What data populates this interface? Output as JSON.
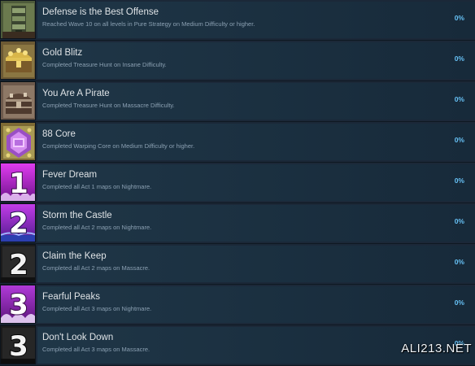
{
  "achievements": [
    {
      "title": "Defense is the Best Offense",
      "desc": "Reached Wave 10 on all levels in Pure Strategy on Medium Difficulty or higher.",
      "percent": "0%",
      "icon": "tower-icon"
    },
    {
      "title": "Gold Blitz",
      "desc": "Completed Treasure Hunt on Insane Difficulty.",
      "percent": "0%",
      "icon": "treasure-chest-icon"
    },
    {
      "title": "You Are A Pirate",
      "desc": "Completed Treasure Hunt on Massacre Difficulty.",
      "percent": "0%",
      "icon": "pirate-chest-icon"
    },
    {
      "title": "88 Core",
      "desc": "Completed Warping Core on Medium Difficulty or higher.",
      "percent": "0%",
      "icon": "core-crystal-icon"
    },
    {
      "title": "Fever Dream",
      "desc": "Completed all Act 1 maps on Nightmare.",
      "percent": "0%",
      "icon": "act-1-nightmare-icon",
      "badge_number": "1"
    },
    {
      "title": "Storm the Castle",
      "desc": "Completed all Act 2 maps on Nightmare.",
      "percent": "0%",
      "icon": "act-2-nightmare-icon",
      "badge_number": "2"
    },
    {
      "title": "Claim the Keep",
      "desc": "Completed all Act 2 maps on Massacre.",
      "percent": "0%",
      "icon": "act-2-massacre-icon",
      "badge_number": "2"
    },
    {
      "title": "Fearful Peaks",
      "desc": "Completed all Act 3 maps on Nightmare.",
      "percent": "0%",
      "icon": "act-3-nightmare-icon",
      "badge_number": "3"
    },
    {
      "title": "Don't Look Down",
      "desc": "Completed all Act 3 maps on Massacre.",
      "percent": "0%",
      "icon": "act-3-massacre-icon",
      "badge_number": "3"
    }
  ],
  "watermark": "ALI213.NET",
  "colors": {
    "background": "#1b2838",
    "percent": "#66c0f4",
    "nightmare_badge": "#b02cc8",
    "massacre_badge": "#1a1a1a"
  }
}
